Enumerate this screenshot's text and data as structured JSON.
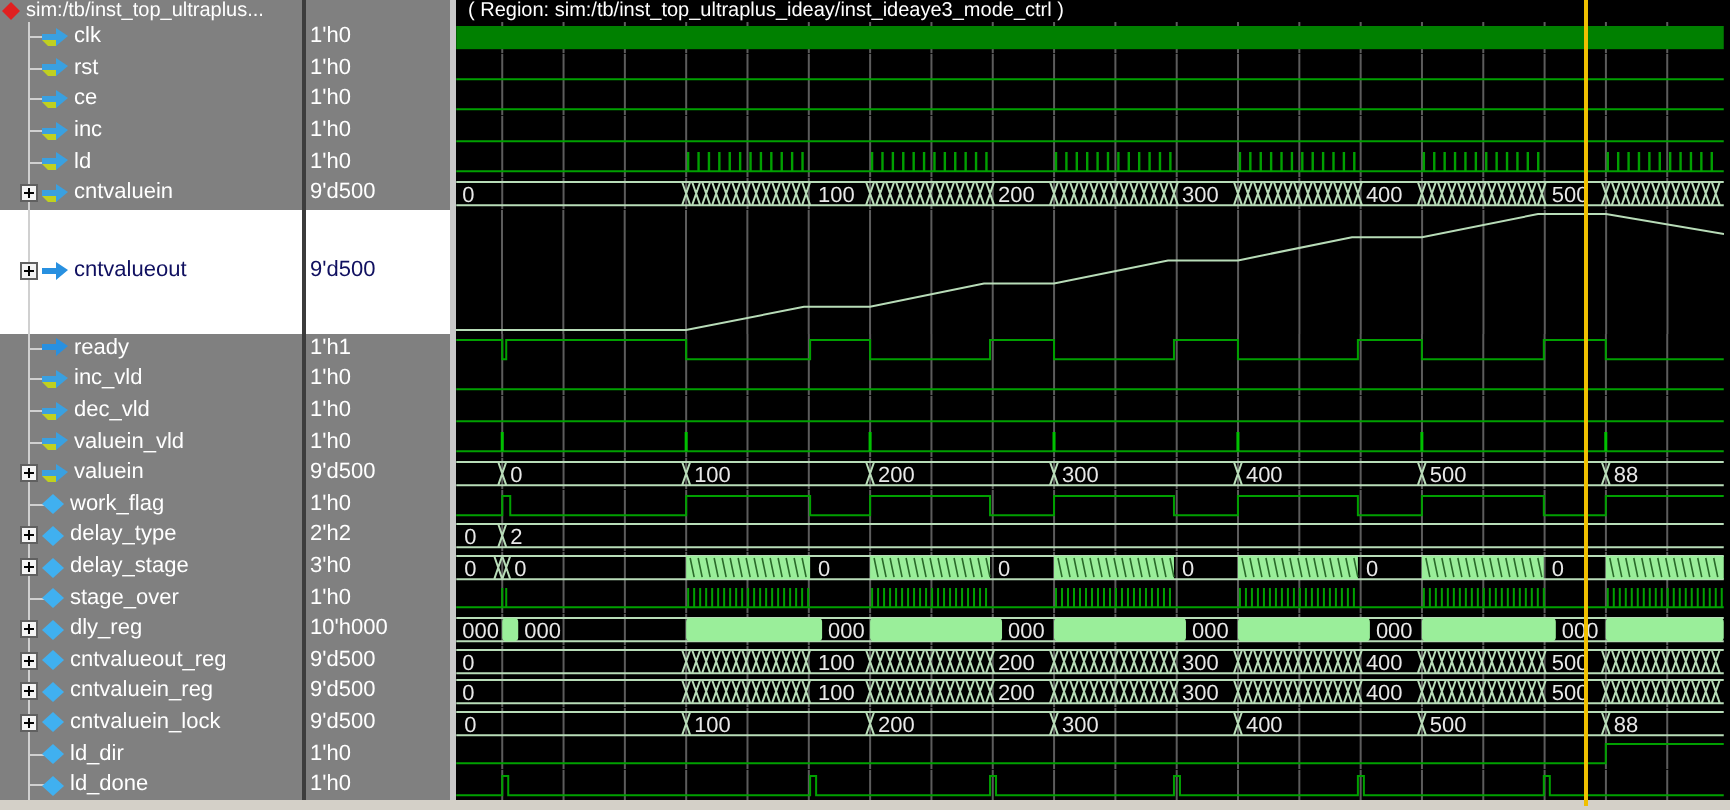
{
  "header": {
    "path": "sim:/tb/inst_top_ultraplus...",
    "region": "( Region: sim:/tb/inst_top_ultraplus_ideay/inst_ideaye3_mode_ctrl )"
  },
  "signals": [
    {
      "name": "clk",
      "value": "1'h0",
      "expandable": false,
      "kind": "in",
      "selected": false,
      "wave": {
        "kind": "bar"
      }
    },
    {
      "name": "rst",
      "value": "1'h0",
      "expandable": false,
      "kind": "in",
      "selected": false,
      "wave": {
        "kind": "low"
      }
    },
    {
      "name": "ce",
      "value": "1'h0",
      "expandable": false,
      "kind": "in",
      "selected": false,
      "wave": {
        "kind": "low"
      }
    },
    {
      "name": "inc",
      "value": "1'h0",
      "expandable": false,
      "kind": "in",
      "selected": false,
      "wave": {
        "kind": "low"
      }
    },
    {
      "name": "ld",
      "value": "1'h0",
      "expandable": false,
      "kind": "in",
      "selected": false,
      "wave": {
        "kind": "ticks"
      }
    },
    {
      "name": "cntvaluein",
      "value": "9'd500",
      "expandable": true,
      "kind": "in",
      "selected": false,
      "wave": {
        "kind": "counting",
        "labels": [
          "0",
          "100",
          "200",
          "300",
          "400",
          "500"
        ]
      }
    },
    {
      "name": "cntvalueout",
      "value": "9'd500",
      "expandable": true,
      "kind": "out",
      "selected": true,
      "wave": {
        "kind": "analog"
      }
    },
    {
      "name": "ready",
      "value": "1'h1",
      "expandable": false,
      "kind": "out",
      "selected": false,
      "wave": {
        "kind": "ready"
      }
    },
    {
      "name": "inc_vld",
      "value": "1'h0",
      "expandable": false,
      "kind": "in",
      "selected": false,
      "wave": {
        "kind": "low"
      }
    },
    {
      "name": "dec_vld",
      "value": "1'h0",
      "expandable": false,
      "kind": "in",
      "selected": false,
      "wave": {
        "kind": "low"
      }
    },
    {
      "name": "valuein_vld",
      "value": "1'h0",
      "expandable": false,
      "kind": "in",
      "selected": false,
      "wave": {
        "kind": "spikes"
      }
    },
    {
      "name": "valuein",
      "value": "9'd500",
      "expandable": true,
      "kind": "in",
      "selected": false,
      "wave": {
        "kind": "step_late",
        "labels": [
          "0",
          "100",
          "200",
          "300",
          "400",
          "500",
          "88"
        ]
      }
    },
    {
      "name": "work_flag",
      "value": "1'h0",
      "expandable": false,
      "kind": "internal",
      "selected": false,
      "wave": {
        "kind": "window_high"
      }
    },
    {
      "name": "delay_type",
      "value": "2'h2",
      "expandable": true,
      "kind": "internal",
      "selected": false,
      "wave": {
        "kind": "step_early",
        "labels": [
          "0",
          "2"
        ]
      }
    },
    {
      "name": "delay_stage",
      "value": "3'h0",
      "expandable": true,
      "kind": "internal",
      "selected": false,
      "wave": {
        "kind": "burst",
        "labels": [
          "0",
          "0",
          "0",
          "0",
          "0",
          "0",
          "0"
        ]
      }
    },
    {
      "name": "stage_over",
      "value": "1'h0",
      "expandable": false,
      "kind": "internal",
      "selected": false,
      "wave": {
        "kind": "dense"
      }
    },
    {
      "name": "dly_reg",
      "value": "10'h000",
      "expandable": true,
      "kind": "internal",
      "selected": false,
      "wave": {
        "kind": "filled",
        "labels": [
          "000",
          "000",
          "000",
          "000",
          "000",
          "000",
          "000"
        ]
      }
    },
    {
      "name": "cntvalueout_reg",
      "value": "9'd500",
      "expandable": true,
      "kind": "internal",
      "selected": false,
      "wave": {
        "kind": "counting",
        "labels": [
          "0",
          "100",
          "200",
          "300",
          "400",
          "500"
        ]
      }
    },
    {
      "name": "cntvaluein_reg",
      "value": "9'd500",
      "expandable": true,
      "kind": "internal",
      "selected": false,
      "wave": {
        "kind": "counting",
        "labels": [
          "0",
          "100",
          "200",
          "300",
          "400",
          "500"
        ]
      }
    },
    {
      "name": "cntvaluein_lock",
      "value": "9'd500",
      "expandable": true,
      "kind": "internal",
      "selected": false,
      "wave": {
        "kind": "step",
        "labels": [
          "0",
          "100",
          "200",
          "300",
          "400",
          "500",
          "88"
        ]
      }
    },
    {
      "name": "ld_dir",
      "value": "1'h0",
      "expandable": false,
      "kind": "internal",
      "selected": false,
      "wave": {
        "kind": "late_high"
      }
    },
    {
      "name": "ld_done",
      "value": "1'h0",
      "expandable": false,
      "kind": "internal",
      "selected": false,
      "wave": {
        "kind": "end_pulses"
      }
    }
  ]
}
